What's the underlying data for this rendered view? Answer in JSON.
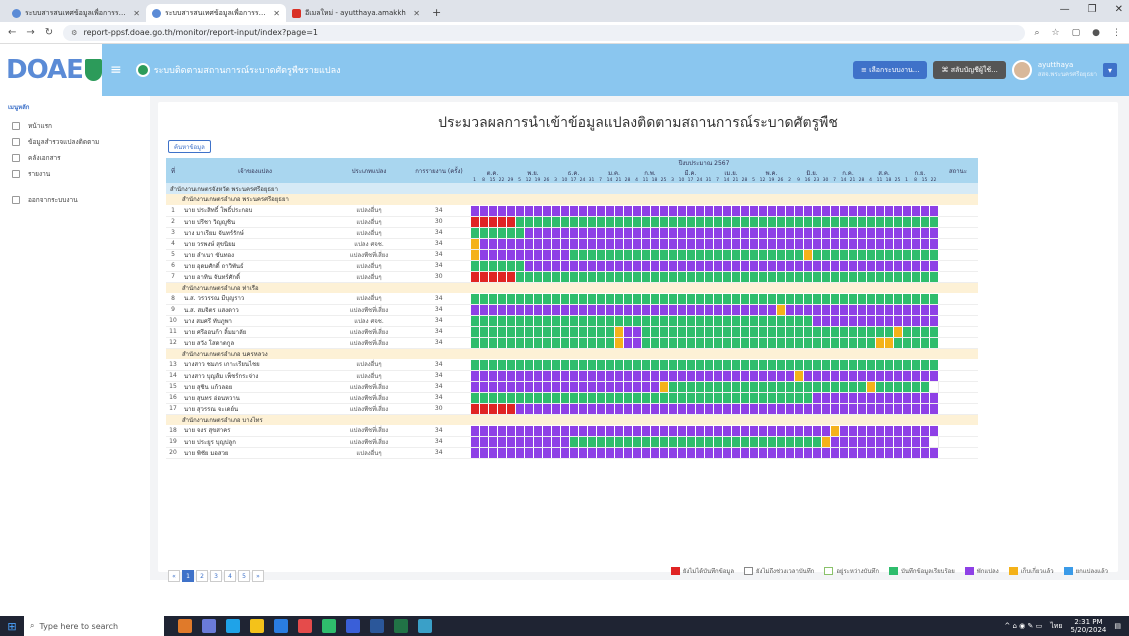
{
  "browser": {
    "tabs": [
      {
        "label": "ระบบสารสนเทศข้อมูลเพื่อการรายงาน",
        "active": false
      },
      {
        "label": "ระบบสารสนเทศข้อมูลเพื่อการรายงาน",
        "active": true
      },
      {
        "label": "อีเมลใหม่ - ayutthaya.amakkh",
        "active": false
      }
    ],
    "url": "report-ppsf.doae.go.th/monitor/report-input/index?page=1"
  },
  "header": {
    "logo_text": "DOAE",
    "system_title": "ระบบติดตามสถานการณ์ระบาดศัตรูพืชรายแปลง",
    "btn_manual": "≡ เลือกระบบงาน...",
    "btn_account": "⌘ สลับบัญชีผู้ใช้...",
    "user_name": "ayutthaya",
    "user_sub": "สสจ.พระนครศรีอยุธยา"
  },
  "sidebar": {
    "title": "เมนูหลัก",
    "items": [
      "หน้าแรก",
      "ข้อมูลสำรวจแปลงติดตาม",
      "คลังเอกสาร",
      "รายงาน",
      "ออกจากระบบงาน"
    ]
  },
  "page": {
    "title": "ประมวลผลการนำเข้าข้อมูลแปลงติดตามสถานการณ์ระบาดศัตรูพืช",
    "search_btn": "ค้นหาข้อมูล",
    "cols": {
      "no": "ที่",
      "owner": "เจ้าของแปลง",
      "type": "ประเภทแปลง",
      "count": "การรายงาน (ครั้ง)",
      "status": "สถานะ"
    },
    "year": "ปีงบประมาณ 2567",
    "months": [
      "ต.ค.",
      "พ.ย.",
      "ธ.ค.",
      "ม.ค.",
      "ก.พ.",
      "มี.ค.",
      "เม.ย.",
      "พ.ค.",
      "มิ.ย.",
      "ก.ค.",
      "ส.ค.",
      "ก.ย."
    ],
    "day_ticks": [
      "1",
      "8",
      "15",
      "22",
      "29",
      "5",
      "12",
      "19",
      "26",
      "3",
      "10",
      "17",
      "24",
      "31",
      "7",
      "14",
      "21",
      "28",
      "4",
      "11",
      "18",
      "25",
      "3",
      "10",
      "17",
      "24",
      "31",
      "7",
      "14",
      "21",
      "28",
      "5",
      "12",
      "19",
      "26",
      "2",
      "9",
      "16",
      "23",
      "30",
      "7",
      "14",
      "21",
      "28",
      "4",
      "11",
      "18",
      "25",
      "1",
      "8",
      "15",
      "22",
      "29"
    ],
    "province": "สำนักงานเกษตรจังหวัด พระนครศรีอยุธยา",
    "groups": [
      {
        "district": "สำนักงานเกษตรอำเภอ พระนครศรีอยุธยา",
        "rows": [
          {
            "no": "1",
            "name": "นาย ประสิทธิ์ โพธิ์ประกอบ",
            "type": "แปลงอื่นๆ",
            "count": "34",
            "cells": "pppppppppppppppppppppppppppppppppppppppppppppppppppp"
          },
          {
            "no": "2",
            "name": "นาย ปรีชา วิญญูชิน",
            "type": "แปลงอื่นๆ",
            "count": "30",
            "cells": "rrrrrggggggggggggggggggggggggggggggggggggggggggggggg"
          },
          {
            "no": "3",
            "name": "นาง มาเรียม จันทร์รักษ์",
            "type": "แปลงอื่นๆ",
            "count": "34",
            "cells": "ggggggppppppppppppppppppppppppppppppppppppppppppppppp"
          },
          {
            "no": "4",
            "name": "นาย วรพงษ์ สุขนิยม",
            "type": "แปลง ศจช.",
            "count": "34",
            "cells": "ypppppppppppppppppppppppppppppppppppppppppppppppppppp"
          },
          {
            "no": "5",
            "name": "นาย ลำเนา ขันทอง",
            "type": "แปลงพืชที่เสี่ยง",
            "count": "34",
            "cells": "yppppppppppggggggggggggggggggggggggggyggggggggggggggg"
          },
          {
            "no": "6",
            "name": "นาย อุดมศักดิ์ ถาวิพันธ์",
            "type": "แปลงอื่นๆ",
            "count": "34",
            "cells": "ggggggppppppppppppppppppppppppppppppppppppppppppppppp"
          },
          {
            "no": "7",
            "name": "นาย อาทิน จันทร์ศักดิ์",
            "type": "แปลงอื่นๆ",
            "count": "30",
            "cells": "rrrrrggggggggggggggggggggggggggggggggggggggggggggggg"
          }
        ]
      },
      {
        "district": "สำนักงานเกษตรอำเภอ ท่าเรือ",
        "rows": [
          {
            "no": "8",
            "name": "น.ส. วรวรรณ มีบุญราว",
            "type": "แปลงอื่นๆ",
            "count": "34",
            "cells": "gggggggggggggggggggggggggggggggggggggggggggggggggggg"
          },
          {
            "no": "9",
            "name": "น.ส. สมจิตร แสงดาว",
            "type": "แปลงพืชที่เสี่ยง",
            "count": "34",
            "cells": "ppppppppppppppppppppppppppppppppppyppppppppppppppppp"
          },
          {
            "no": "10",
            "name": "นาง สมศรี ทับภูพา",
            "type": "แปลง ศจช.",
            "count": "34",
            "cells": "ggggggggggggggggggggggggggggggggggggggpppppppppppppp"
          },
          {
            "no": "11",
            "name": "นาย ศรีออนก้า ลิ้มมาลัย",
            "type": "แปลงพืชที่เสี่ยง",
            "count": "34",
            "cells": "ggggggggggggggggyppggggggggggggggggggggggggggggyggggg"
          },
          {
            "no": "12",
            "name": "นาย สวัง โสดาดกูล",
            "type": "แปลงพืชที่เสี่ยง",
            "count": "34",
            "cells": "ggggggggggggggggyppggggggggggggggggggggggggggyyggggg"
          }
        ]
      },
      {
        "district": "สำนักงานเกษตรอำเภอ นครหลวง",
        "rows": [
          {
            "no": "13",
            "name": "นางสาว ชมภร เกาะเรียนไชย",
            "type": "แปลงอื่นๆ",
            "count": "34",
            "cells": "gggggggggggggggggggggggggggggggggggggggggggggggggggg"
          },
          {
            "no": "14",
            "name": "นางสาว บุญส้ม เพ็ชร์กระจ่าง",
            "type": "แปลงอื่นๆ",
            "count": "34",
            "cells": "ppppppppppppppppppppppppppppppppppppyppppppppppppppp"
          },
          {
            "no": "15",
            "name": "นาย สุชิน แก้วลอย",
            "type": "แปลงพืชที่เสี่ยง",
            "count": "34",
            "cells": "pppppppppppppppppppppyggggggggggggggggggggggygggggg"
          },
          {
            "no": "16",
            "name": "นาย สุนทร อ่อนหวาน",
            "type": "แปลงพืชที่เสี่ยง",
            "count": "34",
            "cells": "ggggggggggggggggggggggggggggggggggggggppppppppppppppp"
          },
          {
            "no": "17",
            "name": "นาย สุวรรณ จะเดย์น",
            "type": "แปลงพืชที่เสี่ยง",
            "count": "30",
            "cells": "rrrrrppppppppppppppppppppppppppppppppppppppppppppppp"
          }
        ]
      },
      {
        "district": "สำนักงานเกษตรอำเภอ บางไทร",
        "rows": [
          {
            "no": "18",
            "name": "นาย จงร สุขสาคร",
            "type": "แปลงพืชที่เสี่ยง",
            "count": "34",
            "cells": "ppppppppppppppppppppppppppppppppppppppppyppppppppppp"
          },
          {
            "no": "19",
            "name": "นาย ประยูร บุญปลูก",
            "type": "แปลงพืชที่เสี่ยง",
            "count": "34",
            "cells": "pppppppppppggggggggggggggggggggggggggggyppppppppppp"
          },
          {
            "no": "20",
            "name": "นาย พิชัย มอสวย",
            "type": "แปลงอื่นๆ",
            "count": "34",
            "cells": "pppppppppppppppppppppppppppppppppppppppppppppppppppp"
          }
        ]
      }
    ],
    "legend": [
      {
        "label": "ยังไม่ได้บันทึกข้อมูล",
        "color": "#e02424"
      },
      {
        "label": "ยังไม่ถึงช่วงเวลาบันทึก",
        "color": "#ffffff"
      },
      {
        "label": "อยู่ระหว่างบันทึก",
        "color": "#ffffff"
      },
      {
        "label": "บันทึกข้อมูลเรียบร้อย",
        "color": "#2fbd6d"
      },
      {
        "label": "พักแปลง",
        "color": "#8e40e6"
      },
      {
        "label": "เก็บเกี่ยวแล้ว",
        "color": "#f4b21a"
      },
      {
        "label": "ยกแปลงแล้ว",
        "color": "#3b9be8"
      }
    ],
    "pages": [
      "«",
      "1",
      "2",
      "3",
      "4",
      "5",
      "»"
    ],
    "current_page": "1"
  },
  "taskbar": {
    "search_placeholder": "Type here to search",
    "time": "2:31 PM",
    "date": "5/20/2024",
    "lang": "ไทย"
  }
}
